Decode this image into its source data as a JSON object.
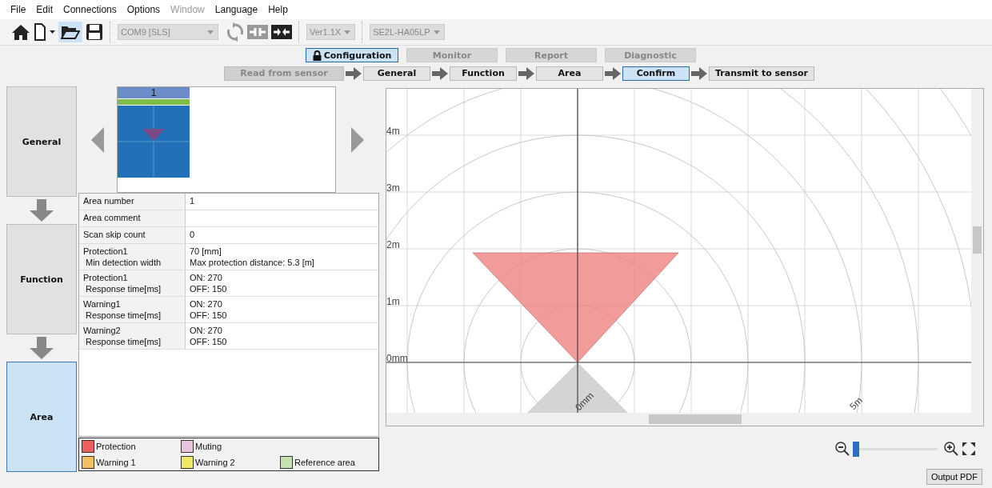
{
  "menu": [
    {
      "label": "File",
      "disabled": false
    },
    {
      "label": "Edit",
      "disabled": false
    },
    {
      "label": "Connections",
      "disabled": false
    },
    {
      "label": "Options",
      "disabled": false
    },
    {
      "label": "Window",
      "disabled": true
    },
    {
      "label": "Language",
      "disabled": false
    },
    {
      "label": "Help",
      "disabled": false
    }
  ],
  "toolbar": {
    "port": "COM9 [SLS]",
    "version": "Ver1.1X",
    "model": "SE2L-HA05LP"
  },
  "modes": [
    {
      "label": "Configuration",
      "selected": true
    },
    {
      "label": "Monitor",
      "selected": false
    },
    {
      "label": "Report",
      "selected": false
    },
    {
      "label": "Diagnostic",
      "selected": false
    }
  ],
  "steps": [
    {
      "label": "Read from sensor",
      "selected": false,
      "disabled": true
    },
    {
      "label": "General",
      "selected": false,
      "disabled": false
    },
    {
      "label": "Function",
      "selected": false,
      "disabled": false
    },
    {
      "label": "Area",
      "selected": false,
      "disabled": false
    },
    {
      "label": "Confirm",
      "selected": true,
      "disabled": false
    },
    {
      "label": "Transmit to sensor",
      "selected": false,
      "disabled": false
    }
  ],
  "sidebar": [
    {
      "label": "General",
      "selected": false
    },
    {
      "label": "Function",
      "selected": false
    },
    {
      "label": "Area",
      "selected": true
    }
  ],
  "area_thumbnail": {
    "number": "1"
  },
  "properties": [
    {
      "label": [
        "Area number"
      ],
      "value": [
        "1"
      ]
    },
    {
      "label": [
        "Area comment"
      ]
    },
    {
      "label": [
        "Scan skip count"
      ],
      "value": [
        "0"
      ]
    },
    {
      "label": [
        "Protection1",
        "Min detection width"
      ],
      "value": [
        "70 [mm]",
        "Max protection distance: 5.3 [m]"
      ]
    },
    {
      "label": [
        "Protection1",
        "Response time[ms]"
      ],
      "value": [
        "ON: 270",
        "OFF: 150"
      ]
    },
    {
      "label": [
        "Warning1",
        "Response time[ms]"
      ],
      "value": [
        "ON: 270",
        "OFF: 150"
      ]
    },
    {
      "label": [
        "Warning2",
        "Response time[ms]"
      ],
      "value": [
        "ON: 270",
        "OFF: 150"
      ]
    }
  ],
  "legend": [
    {
      "label": "Protection",
      "color": "#ee6060"
    },
    {
      "label": "Muting",
      "color": "#e8c4dc"
    },
    {
      "label": "Warning 1",
      "color": "#f2bf63"
    },
    {
      "label": "Warning 2",
      "color": "#eeea66"
    },
    {
      "label": "Reference area",
      "color": "#c6e0ae"
    }
  ],
  "canvas": {
    "y_labels": [
      "4m",
      "3m",
      "2m",
      "1m",
      "0mm"
    ],
    "arc_labels": [
      "0mm",
      "5m"
    ]
  },
  "zoom": {
    "level": 0.0
  },
  "output_button": "Output PDF"
}
